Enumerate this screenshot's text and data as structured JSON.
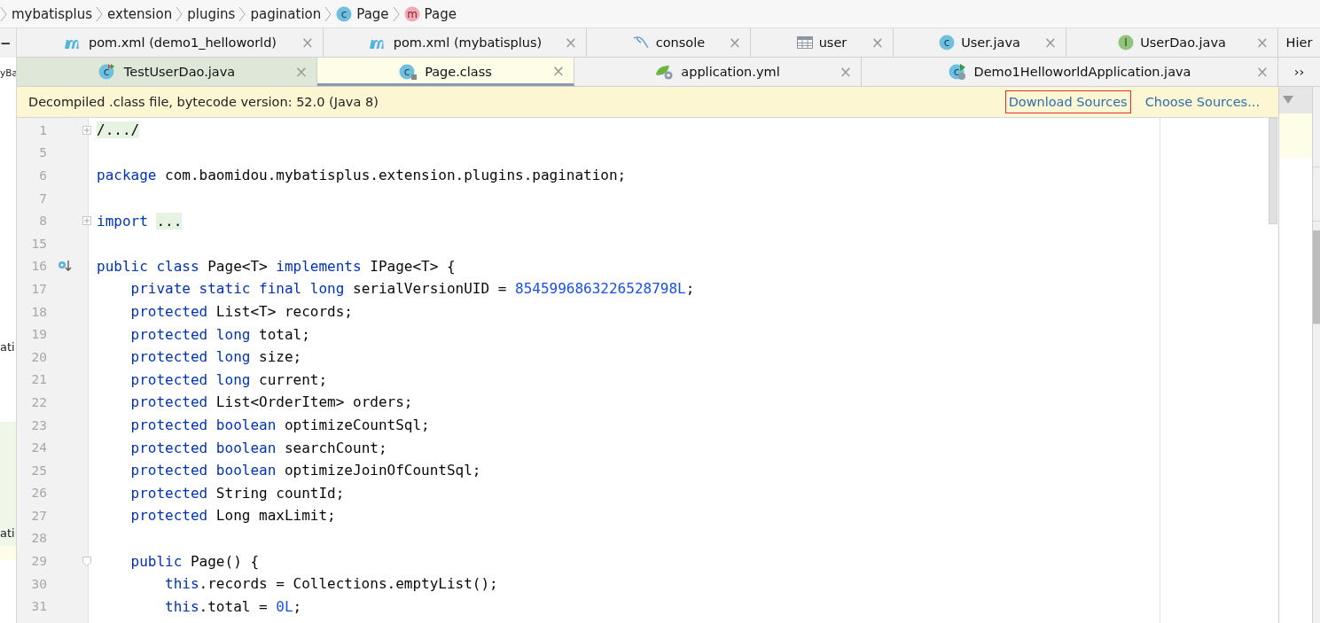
{
  "breadcrumb": [
    {
      "label": "mybatisplus"
    },
    {
      "label": "extension"
    },
    {
      "label": "plugins"
    },
    {
      "label": "pagination"
    },
    {
      "label": "Page",
      "kind": "class",
      "icon_text": "c"
    },
    {
      "label": "Page",
      "kind": "method",
      "icon_text": "m"
    }
  ],
  "left_panel": {
    "collapse": "−",
    "fragments": [
      "yBa",
      "ati",
      "ati"
    ]
  },
  "tab_rows": [
    [
      {
        "label": "pom.xml (demo1_helloworld)",
        "kind": "maven",
        "selected": false,
        "close": "×"
      },
      {
        "label": "pom.xml (mybatisplus)",
        "kind": "maven",
        "selected": false,
        "close": "×"
      },
      {
        "label": "console",
        "kind": "database",
        "selected": false,
        "close": "×"
      },
      {
        "label": "user",
        "kind": "table",
        "selected": false,
        "close": "×"
      },
      {
        "label": "User.java",
        "kind": "class",
        "icon_text": "c",
        "selected": false,
        "close": "×"
      },
      {
        "label": "UserDao.java",
        "kind": "interface",
        "icon_text": "I",
        "selected": false,
        "close": "×"
      },
      {
        "label": "Hier",
        "selected": false
      }
    ],
    [
      {
        "label": "TestUserDao.java",
        "kind": "testclass",
        "icon_text": "c",
        "selected": false,
        "close": "×"
      },
      {
        "label": "Page.class",
        "kind": "classlock",
        "icon_text": "c",
        "selected": true,
        "close": "×"
      },
      {
        "label": "application.yml",
        "kind": "spring",
        "selected": false,
        "close": "×"
      },
      {
        "label": "Demo1HelloworldApplication.java",
        "kind": "springclass",
        "icon_text": "c",
        "selected": false,
        "close": "×"
      },
      {
        "label": "››",
        "selected": false
      }
    ]
  ],
  "tool_windows": [
    {
      "selected": false
    },
    {
      "selected": false
    },
    {
      "selected": true
    }
  ],
  "banner": {
    "message": "Decompiled .class file, bytecode version: 52.0 (Java 8)",
    "actions": [
      {
        "label": "Download Sources",
        "focused": true
      },
      {
        "label": "Choose Sources...",
        "focused": false
      }
    ]
  },
  "editor": {
    "lines": [
      {
        "number": "1",
        "kind": "folded",
        "tokens": [
          {
            "kind": "folded",
            "text": "/.../"
          }
        ]
      },
      {
        "number": "5",
        "kind": "plain"
      },
      {
        "number": "6",
        "kind": "plain",
        "tokens": [
          {
            "kind": "keyword",
            "text": "package"
          },
          {
            "kind": "plain",
            "text": " com.baomidou.mybatisplus.extension.plugins.pagination;"
          }
        ]
      },
      {
        "number": "7",
        "kind": "plain"
      },
      {
        "number": "8",
        "kind": "folded",
        "tokens": [
          {
            "kind": "keyword",
            "text": "import "
          },
          {
            "kind": "folded",
            "text": "..."
          }
        ]
      },
      {
        "number": "15",
        "kind": "plain"
      },
      {
        "number": "16",
        "kind": "marked",
        "tokens": [
          {
            "kind": "keyword",
            "text": "public class"
          },
          {
            "kind": "plain",
            "text": " Page<T> "
          },
          {
            "kind": "keyword",
            "text": "implements"
          },
          {
            "kind": "plain",
            "text": " IPage<T> {"
          }
        ]
      },
      {
        "number": "17",
        "kind": "plain",
        "tokens": [
          {
            "kind": "keyword",
            "text": "    private static final long"
          },
          {
            "kind": "plain",
            "text": " serialVersionUID = "
          },
          {
            "kind": "number",
            "text": "8545996863226528798L"
          },
          {
            "kind": "plain",
            "text": ";"
          }
        ]
      },
      {
        "number": "18",
        "kind": "plain",
        "tokens": [
          {
            "kind": "keyword",
            "text": "    protected"
          },
          {
            "kind": "plain",
            "text": " List<T> records;"
          }
        ]
      },
      {
        "number": "19",
        "kind": "plain",
        "tokens": [
          {
            "kind": "keyword",
            "text": "    protected long"
          },
          {
            "kind": "plain",
            "text": " total;"
          }
        ]
      },
      {
        "number": "20",
        "kind": "plain",
        "tokens": [
          {
            "kind": "keyword",
            "text": "    protected long"
          },
          {
            "kind": "plain",
            "text": " size;"
          }
        ]
      },
      {
        "number": "21",
        "kind": "plain",
        "tokens": [
          {
            "kind": "keyword",
            "text": "    protected long"
          },
          {
            "kind": "plain",
            "text": " current;"
          }
        ]
      },
      {
        "number": "22",
        "kind": "plain",
        "tokens": [
          {
            "kind": "keyword",
            "text": "    protected"
          },
          {
            "kind": "plain",
            "text": " List<OrderItem> orders;"
          }
        ]
      },
      {
        "number": "23",
        "kind": "plain",
        "tokens": [
          {
            "kind": "keyword",
            "text": "    protected boolean"
          },
          {
            "kind": "plain",
            "text": " optimizeCountSql;"
          }
        ]
      },
      {
        "number": "24",
        "kind": "plain",
        "tokens": [
          {
            "kind": "keyword",
            "text": "    protected boolean"
          },
          {
            "kind": "plain",
            "text": " searchCount;"
          }
        ]
      },
      {
        "number": "25",
        "kind": "plain",
        "tokens": [
          {
            "kind": "keyword",
            "text": "    protected boolean"
          },
          {
            "kind": "plain",
            "text": " optimizeJoinOfCountSql;"
          }
        ]
      },
      {
        "number": "26",
        "kind": "plain",
        "tokens": [
          {
            "kind": "keyword",
            "text": "    protected"
          },
          {
            "kind": "plain",
            "text": " String countId;"
          }
        ]
      },
      {
        "number": "27",
        "kind": "plain",
        "tokens": [
          {
            "kind": "keyword",
            "text": "    protected"
          },
          {
            "kind": "plain",
            "text": " Long maxLimit;"
          }
        ]
      },
      {
        "number": "28",
        "kind": "plain"
      },
      {
        "number": "29",
        "kind": "fold-start",
        "tokens": [
          {
            "kind": "keyword",
            "text": "    public"
          },
          {
            "kind": "plain",
            "text": " Page() {"
          }
        ]
      },
      {
        "number": "30",
        "kind": "plain",
        "tokens": [
          {
            "kind": "keyword",
            "text": "        this"
          },
          {
            "kind": "plain",
            "text": ".records = Collections.emptyList();"
          }
        ]
      },
      {
        "number": "31",
        "kind": "plain",
        "tokens": [
          {
            "kind": "keyword",
            "text": "        this"
          },
          {
            "kind": "plain",
            "text": ".total = "
          },
          {
            "kind": "number",
            "text": "0L"
          },
          {
            "kind": "plain",
            "text": ";"
          }
        ]
      }
    ]
  }
}
